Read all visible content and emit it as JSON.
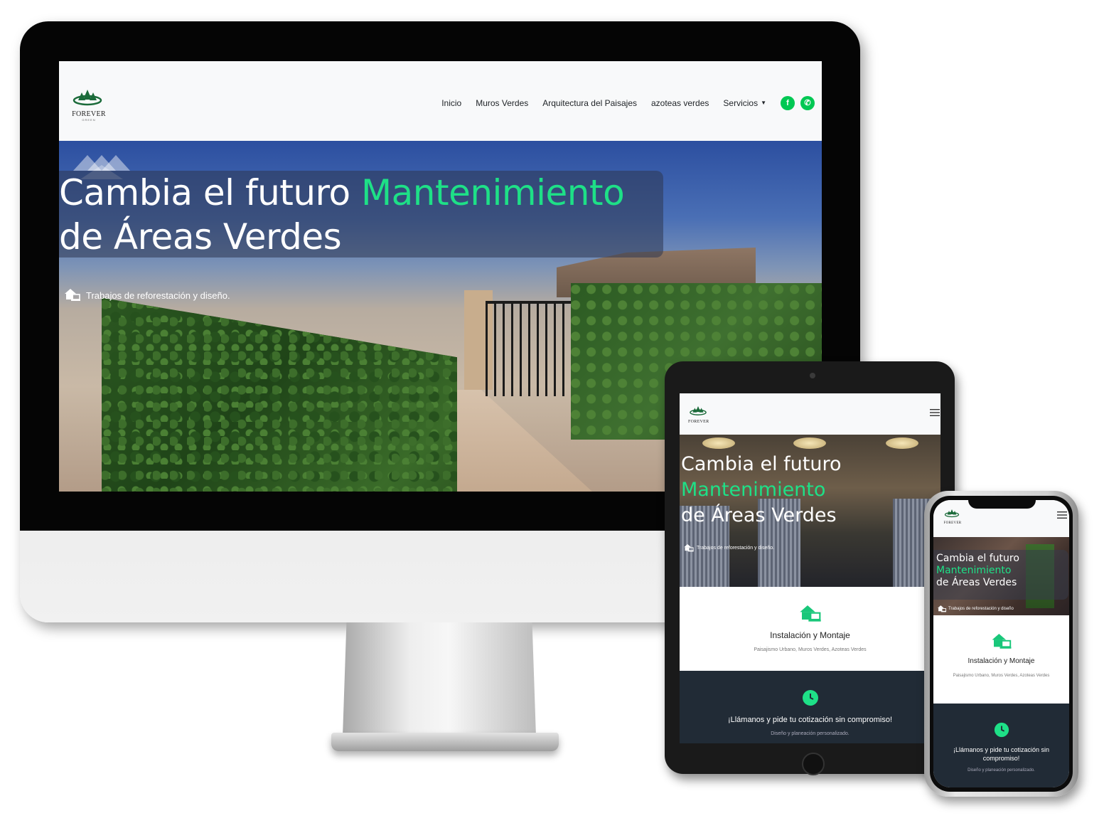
{
  "brand": {
    "name": "FOREVER",
    "tagline": "GREEN"
  },
  "nav": {
    "items": [
      "Inicio",
      "Muros Verdes",
      "Arquitectura del Paisajes",
      "azoteas verdes",
      "Servicios"
    ],
    "social": [
      {
        "icon": "facebook-icon",
        "glyph": "f"
      },
      {
        "icon": "whatsapp-icon",
        "glyph": "✆"
      }
    ]
  },
  "hero": {
    "title_part1": "Cambia el futuro",
    "title_highlight": "Mantenimiento",
    "title_part2": "de Áreas Verdes",
    "subtitle": "Trabajos de reforestación y diseño.",
    "phone_subtitle": "Trabajos de reforestación y diseño"
  },
  "features": [
    {
      "icon": "house-laptop-icon",
      "title": "Instalación y Montaje",
      "text": "Paisajismo Urbano, Muros Verdes, Azoteas Verdes"
    },
    {
      "icon": "clock-icon",
      "title": "¡Llámanos y pide tu cotización sin compromiso!",
      "text": "Diseño y planeación personalizado."
    }
  ],
  "colors": {
    "accent": "#1ee087",
    "social_green": "#00c853",
    "dark_section": "#212b36",
    "navbar": "#f8f9fa"
  }
}
